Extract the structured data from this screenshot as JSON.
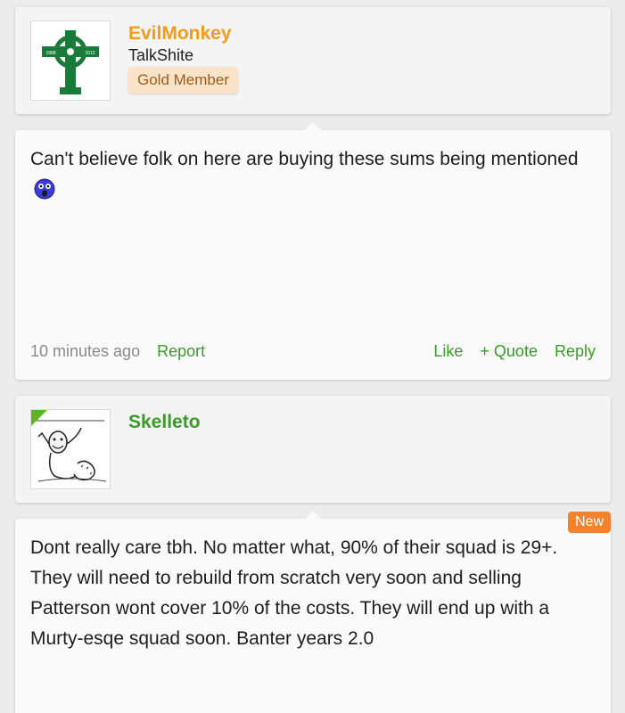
{
  "posts": [
    {
      "username": "EvilMonkey",
      "user_title": "TalkShite",
      "badge": "Gold Member",
      "avatar_icon": "celtic-cross-logo-icon",
      "avatar_text": [
        "1888",
        "2013"
      ],
      "message": "Can't believe folk on here are buying these sums being mentioned",
      "emoji_icon": "shocked-face-icon",
      "time": "10 minutes ago",
      "report": "Report",
      "like": "Like",
      "quote": "+ Quote",
      "reply": "Reply"
    },
    {
      "username": "Skelleto",
      "avatar_icon": "meme-cartoon-avatar-icon",
      "new_label": "New",
      "message": "Dont really care tbh. No matter what, 90% of their squad is 29+. They will need to rebuild from scratch very soon and selling Patterson wont cover 10% of the costs. They will end up with a Murty-esqe squad soon. Banter years 2.0"
    }
  ],
  "colors": {
    "username_orange": "#f39c1a",
    "username_green": "#3a9a2a",
    "link_green": "#3a9a2a",
    "new_orange": "#f2822e",
    "badge_bg": "#fae3c8"
  }
}
